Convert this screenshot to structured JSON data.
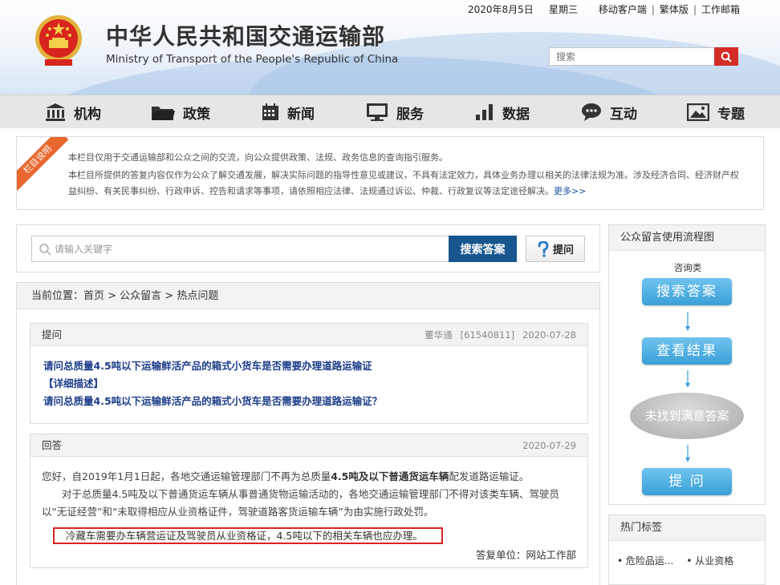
{
  "header": {
    "title_cn": "中华人民共和国交通运输部",
    "title_en": "Ministry of Transport of the People's Republic of China",
    "date": "2020年8月5日",
    "weekday": "星期三",
    "links": [
      "移动客户端",
      "繁体版",
      "工作邮箱"
    ],
    "search_placeholder": "搜索"
  },
  "nav": {
    "items": [
      {
        "label": "机构",
        "icon": "building-icon"
      },
      {
        "label": "政策",
        "icon": "folder-icon"
      },
      {
        "label": "新闻",
        "icon": "calendar-icon"
      },
      {
        "label": "服务",
        "icon": "monitor-icon"
      },
      {
        "label": "数据",
        "icon": "bar-chart-icon"
      },
      {
        "label": "互动",
        "icon": "chat-icon"
      },
      {
        "label": "专题",
        "icon": "image-icon"
      }
    ]
  },
  "notice": {
    "ribbon": "栏目说明",
    "line1": "本栏目仅用于交通运输部和公众之间的交流，向公众提供政策、法规、政务信息的查询指引服务。",
    "line2": "本栏目所提供的答复内容仅作为公众了解交通发展，解决实际问题的指导性意见或建议，不具有法定效力，具体业务办理以相关的法律法规为准。涉及经济合同、经济财产权",
    "line3": "益纠纷、有关民事纠纷、行政申诉、控告和请求等事项，请依照相应法律、法规通过诉讼、仲裁、行政复议等法定途径解决。",
    "more": "更多>>"
  },
  "qsearch": {
    "placeholder": "请输入关键字",
    "button": "搜索答案",
    "ask": "提问"
  },
  "breadcrumb": "当前位置：首页 > 公众留言 > 热点问题",
  "question": {
    "head": "提问",
    "author": "董华通",
    "id": "[61540811]",
    "date": "2020-07-28",
    "title": "请问总质量4.5吨以下运输鲜活产品的箱式小货车是否需要办理道路运输证",
    "detail_label": "【详细描述】",
    "detail": "请问总质量4.5吨以下运输鲜活产品的箱式小货车是否需要办理道路运输证？"
  },
  "answer": {
    "head": "回答",
    "date": "2020-07-29",
    "p1_a": "您好，自2019年1月1日起，各地交通运输管理部门不再为总质量",
    "p1_b": "4.5吨及以下普通货运车辆",
    "p1_c": "配发道路运输证。",
    "p2": "对于总质量4.5吨及以下普通货运车辆从事普通货物运输活动的，各地交通运输管理部门不得对该类车辆、驾驶员以“无证经营”和“未取得相应从业资格证件，驾驶道路客货运输车辆”为由实施行政处罚。",
    "highlight": "冷藏车需要办车辆营运证及驾驶员从业资格证，4.5吨以下的相关车辆也应办理。",
    "signer": "答复单位：网站工作部"
  },
  "sidebar": {
    "flow_title": "公众留言使用流程图",
    "flow_label": "咨询类",
    "step1": "搜索答案",
    "step2": "查看结果",
    "step3": "未找到满意答案",
    "step4": "提 问",
    "tags_title": "热门标签",
    "tags": [
      "危险品运...",
      "从业资格"
    ]
  }
}
